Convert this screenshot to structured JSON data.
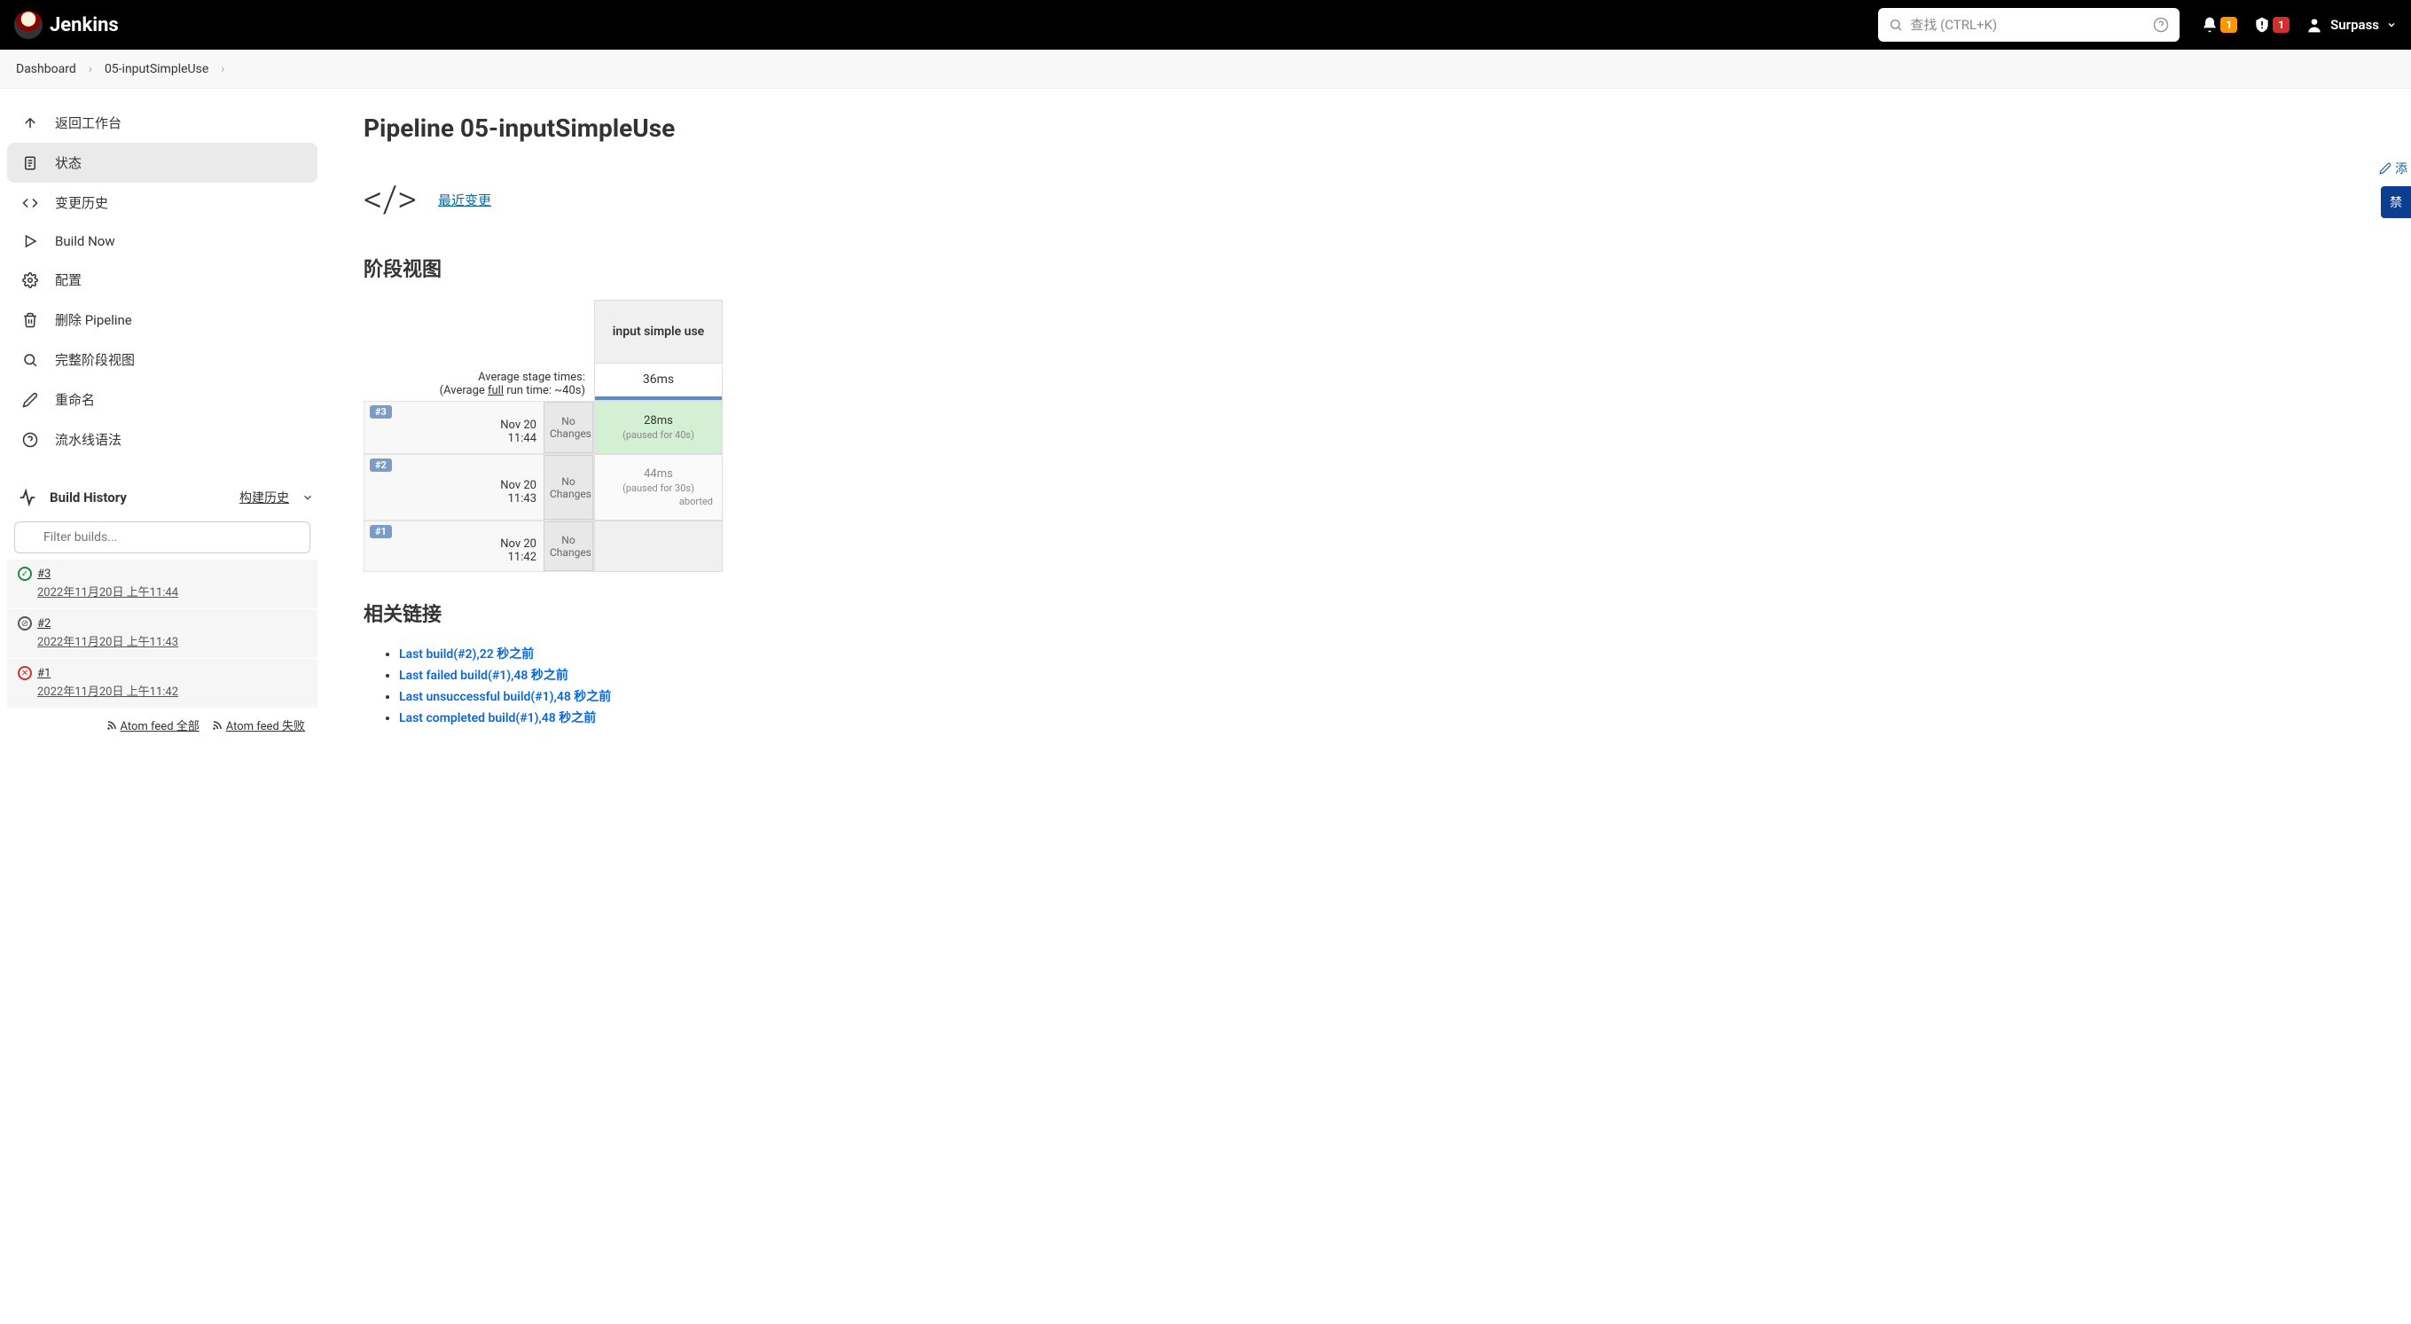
{
  "header": {
    "brand": "Jenkins",
    "search_placeholder": "查找 (CTRL+K)",
    "notif_badge": "1",
    "alert_badge": "1",
    "user": "Surpass"
  },
  "breadcrumbs": {
    "dashboard": "Dashboard",
    "job": "05-inputSimpleUse"
  },
  "sidebar": {
    "back": "返回工作台",
    "status": "状态",
    "changes": "变更历史",
    "build_now": "Build Now",
    "configure": "配置",
    "delete": "删除 Pipeline",
    "full_stage": "完整阶段视图",
    "rename": "重命名",
    "syntax": "流水线语法",
    "build_history_title": "Build History",
    "build_history_link": "构建历史",
    "filter_placeholder": "Filter builds...",
    "builds": [
      {
        "num": "#3",
        "status": "success",
        "date": "2022年11月20日 上午11:44"
      },
      {
        "num": "#2",
        "status": "aborted",
        "date": "2022年11月20日 上午11:43"
      },
      {
        "num": "#1",
        "status": "failed",
        "date": "2022年11月20日 上午11:42"
      }
    ],
    "feed_all": "Atom feed 全部",
    "feed_fail": "Atom feed 失败"
  },
  "main": {
    "title": "Pipeline 05-inputSimpleUse",
    "recent_changes": "最近变更",
    "stage_view_title": "阶段视图",
    "stage_name": "input simple use",
    "avg_label": "Average stage times:",
    "avg_full_label_pre": "(Average ",
    "avg_full_label_mid": "full",
    "avg_full_label_post": " run time: ~40s)",
    "avg_time": "36ms",
    "rows": [
      {
        "badge": "#3",
        "date": "Nov 20",
        "time": "11:44",
        "changes": "No Changes",
        "cell_time": "28ms",
        "cell_note": "(paused for 40s)",
        "cell_class": "cell-success"
      },
      {
        "badge": "#2",
        "date": "Nov 20",
        "time": "11:43",
        "changes": "No Changes",
        "cell_time": "44ms",
        "cell_note": "(paused for 30s)",
        "cell_note2": "aborted",
        "cell_class": "cell-aborted"
      },
      {
        "badge": "#1",
        "date": "Nov 20",
        "time": "11:42",
        "changes": "No Changes",
        "cell_time": "",
        "cell_note": "",
        "cell_class": "cell-empty"
      }
    ],
    "related_title": "相关链接",
    "related_links": [
      "Last build(#2),22 秒之前",
      "Last failed build(#1),48 秒之前",
      "Last unsuccessful build(#1),48 秒之前",
      "Last completed build(#1),48 秒之前"
    ],
    "edit_label": "添",
    "disable_label": "禁"
  }
}
